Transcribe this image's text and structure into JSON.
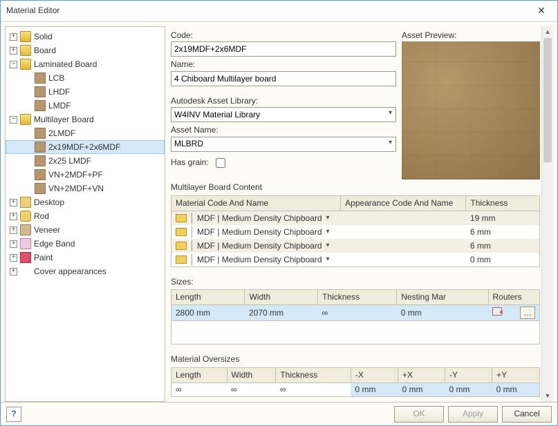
{
  "window": {
    "title": "Material Editor"
  },
  "tree": [
    {
      "depth": 0,
      "expand": "+",
      "icon": "folder",
      "label": "Solid"
    },
    {
      "depth": 0,
      "expand": "+",
      "icon": "folder",
      "label": "Board"
    },
    {
      "depth": 0,
      "expand": "-",
      "icon": "folder",
      "label": "Laminated Board"
    },
    {
      "depth": 1,
      "expand": "",
      "icon": "swatch",
      "label": "LCB"
    },
    {
      "depth": 1,
      "expand": "",
      "icon": "swatch",
      "label": "LHDF"
    },
    {
      "depth": 1,
      "expand": "",
      "icon": "swatch",
      "label": "LMDF"
    },
    {
      "depth": 0,
      "expand": "-",
      "icon": "folder",
      "label": "Multilayer Board"
    },
    {
      "depth": 1,
      "expand": "",
      "icon": "swatch",
      "label": "2LMDF"
    },
    {
      "depth": 1,
      "expand": "",
      "icon": "swatch",
      "label": "2x19MDF+2x6MDF",
      "selected": true
    },
    {
      "depth": 1,
      "expand": "",
      "icon": "swatch",
      "label": "2x25 LMDF"
    },
    {
      "depth": 1,
      "expand": "",
      "icon": "swatch",
      "label": "VN+2MDF+PF"
    },
    {
      "depth": 1,
      "expand": "",
      "icon": "swatch",
      "label": "VN+2MDF+VN"
    },
    {
      "depth": 0,
      "expand": "+",
      "icon": "desktop",
      "label": "Desktop"
    },
    {
      "depth": 0,
      "expand": "+",
      "icon": "rod",
      "label": "Rod"
    },
    {
      "depth": 0,
      "expand": "+",
      "icon": "veneer",
      "label": "Veneer"
    },
    {
      "depth": 0,
      "expand": "+",
      "icon": "edge",
      "label": "Edge Band"
    },
    {
      "depth": 0,
      "expand": "+",
      "icon": "paint",
      "label": "Paint"
    },
    {
      "depth": 0,
      "expand": "+",
      "icon": "",
      "label": "Cover appearances"
    }
  ],
  "labels": {
    "code": "Code:",
    "name": "Name:",
    "asset_lib": "Autodesk Asset Library:",
    "asset_name": "Asset Name:",
    "has_grain": "Has grain:",
    "preview": "Asset Preview:",
    "mlb_content": "Multilayer Board Content",
    "sizes": "Sizes:",
    "oversizes": "Material Oversizes"
  },
  "fields": {
    "code": "2x19MDF+2x6MDF",
    "name": "4 Chiboard Multilayer board",
    "asset_lib": "W4INV Material Library",
    "asset_name": "MLBRD",
    "has_grain": false
  },
  "content_table": {
    "headers": {
      "material": "Material Code And Name",
      "appearance": "Appearance Code And Name",
      "thickness": "Thickness"
    },
    "rows": [
      {
        "material": "MDF | Medium Density Chipboard",
        "appearance": "",
        "thickness": "19 mm"
      },
      {
        "material": "MDF | Medium Density Chipboard",
        "appearance": "",
        "thickness": "6 mm"
      },
      {
        "material": "MDF | Medium Density Chipboard",
        "appearance": "",
        "thickness": "6 mm"
      },
      {
        "material": "MDF | Medium Density Chipboard",
        "appearance": "",
        "thickness": "0 mm"
      }
    ]
  },
  "sizes_table": {
    "headers": {
      "length": "Length",
      "width": "Width",
      "thickness": "Thickness",
      "nesting": "Nesting Mar",
      "routers": "Routers"
    },
    "row": {
      "length": "2800 mm",
      "width": "2070 mm",
      "thickness": "∞",
      "nesting": "0 mm"
    }
  },
  "oversize_table": {
    "headers": {
      "length": "Length",
      "width": "Width",
      "thickness": "Thickness",
      "mx": "-X",
      "px": "+X",
      "my": "-Y",
      "py": "+Y"
    },
    "row": {
      "length": "∞",
      "width": "∞",
      "thickness": "∞",
      "mx": "0 mm",
      "px": "0 mm",
      "my": "0 mm",
      "py": "0 mm"
    }
  },
  "buttons": {
    "ok": "OK",
    "apply": "Apply",
    "cancel": "Cancel",
    "help": "?"
  }
}
